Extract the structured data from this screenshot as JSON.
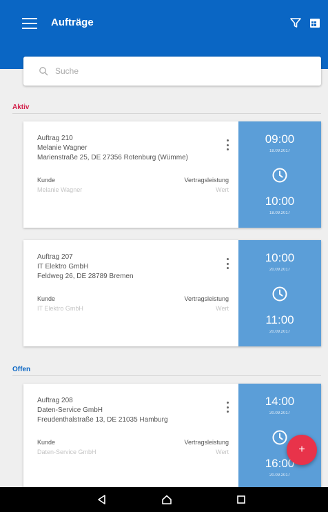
{
  "appbar": {
    "title": "Aufträge",
    "menu_icon": "menu-icon",
    "filter_icon": "filter-icon",
    "calendar_icon": "calendar-icon",
    "color": "#0a66c4"
  },
  "search": {
    "placeholder": "Suche"
  },
  "sections": [
    {
      "label": "Aktiv",
      "color": "#d3214b"
    },
    {
      "label": "Offen",
      "color": "#0a66c4"
    }
  ],
  "cards": [
    {
      "title": "Auftrag 210",
      "name": "Melanie Wagner",
      "address": "Marienstraße 25, DE 27356 Rotenburg (Wümme)",
      "kunde_label": "Kunde",
      "kunde_value": "Melanie Wagner",
      "vertrag_label": "Vertragsleistung",
      "vertrag_value": "Wert",
      "start_time": "09:00",
      "start_date": "18.09.2017",
      "end_time": "10:00",
      "end_date": "18.09.2017"
    },
    {
      "title": "Auftrag 207",
      "name": "IT Elektro GmbH",
      "address": "Feldweg 26, DE 28789 Bremen",
      "kunde_label": "Kunde",
      "kunde_value": "IT Elektro GmbH",
      "vertrag_label": "Vertragsleistung",
      "vertrag_value": "Wert",
      "start_time": "10:00",
      "start_date": "20.09.2017",
      "end_time": "11:00",
      "end_date": "20.09.2017"
    },
    {
      "title": "Auftrag 208",
      "name": "Daten-Service GmbH",
      "address": "Freudenthalstraße 13, DE 21035 Hamburg",
      "kunde_label": "Kunde",
      "kunde_value": "Daten-Service GmbH",
      "vertrag_label": "Vertragsleistung",
      "vertrag_value": "Wert",
      "start_time": "14:00",
      "start_date": "20.09.2017",
      "end_time": "16:00",
      "end_date": "20.09.2017"
    }
  ],
  "fab": {
    "label": "+",
    "icon": "add-icon",
    "color": "#e8334a"
  },
  "navbar": {
    "back_icon": "back-icon",
    "home_icon": "home-icon",
    "recents_icon": "recents-icon"
  }
}
